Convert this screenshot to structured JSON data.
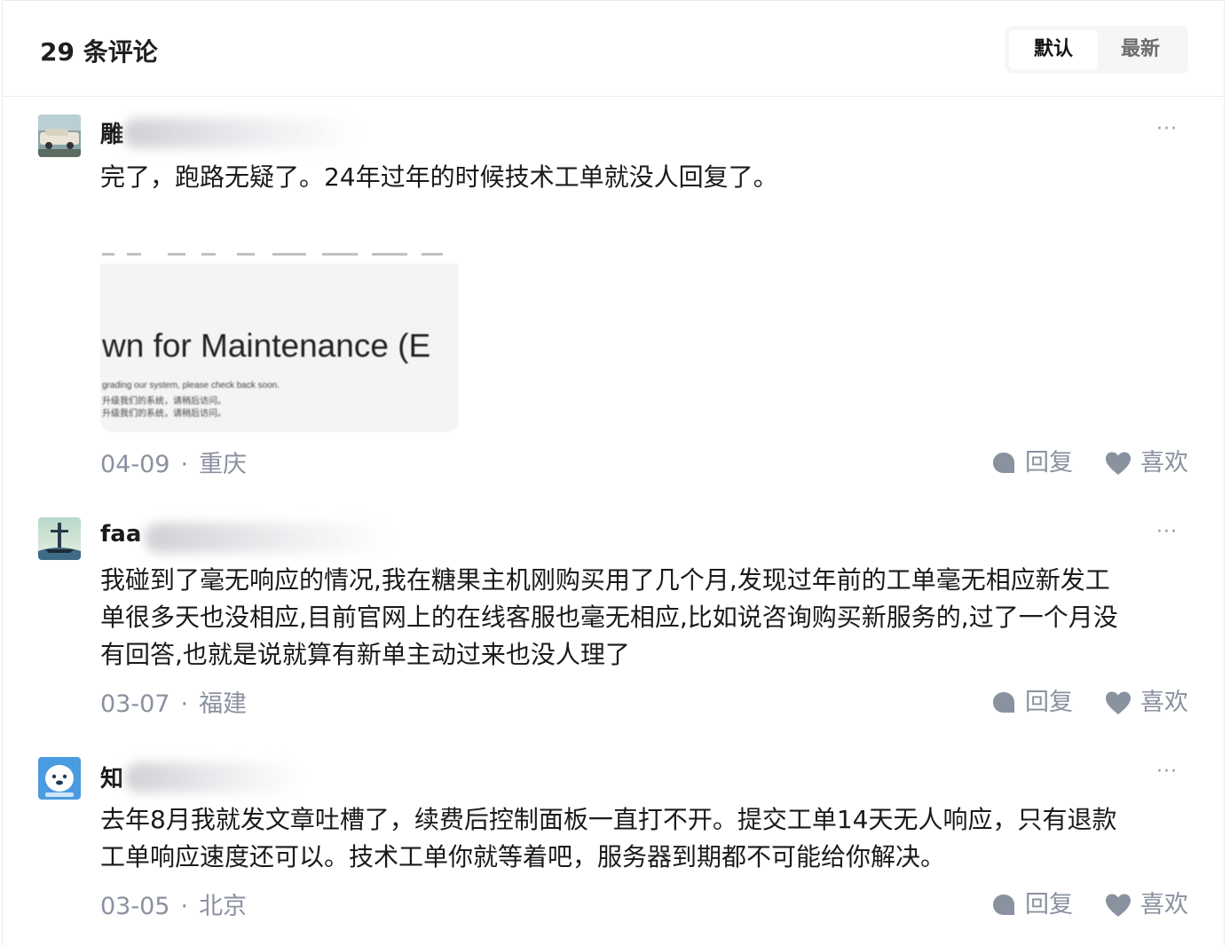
{
  "header": {
    "title": "29 条评论",
    "sort_options": [
      "默认",
      "最新"
    ],
    "sort_selected": "默认"
  },
  "comments": [
    {
      "username": "雕",
      "text": "完了，跑路无疑了。24年过年的时候技术工单就没人回复了。",
      "image_text": {
        "main": "wn for Maintenance (E",
        "line1": "grading our system, please check back soon.",
        "line2": "升级我们的系统，请稍后访问。",
        "line3": "升级我们的系统，请稍后访问。"
      },
      "date": "04-09",
      "location": "重庆",
      "reply_label": "回复",
      "like_label": "喜欢"
    },
    {
      "username": "faa",
      "text_lines": [
        "我碰到了毫无响应的情况,我在糖果主机刚购买用了几个月,发现过年前的工单毫无相应新发工",
        "单很多天也没相应,目前官网上的在线客服也毫无相应,比如说咨询购买新服务的,过了一个月没",
        "有回答,也就是说就算有新单主动过来也没人理了"
      ],
      "date": "03-07",
      "location": "福建",
      "reply_label": "回复",
      "like_label": "喜欢"
    },
    {
      "username": "知",
      "text_lines": [
        "去年8月我就发文章吐槽了，续费后控制面板一直打不开。提交工单14天无人响应，只有退款",
        "工单响应速度还可以。技术工单你就等着吧，服务器到期都不可能给你解决。"
      ],
      "date": "03-05",
      "location": "北京",
      "reply_label": "回复",
      "like_label": "喜欢"
    }
  ],
  "icons": {
    "more": "more-dots-icon",
    "reply": "chat-bubble-icon",
    "like": "heart-icon"
  },
  "colors": {
    "meta": "#8a919f",
    "text": "#1a1a1a",
    "border": "#ebebeb"
  }
}
